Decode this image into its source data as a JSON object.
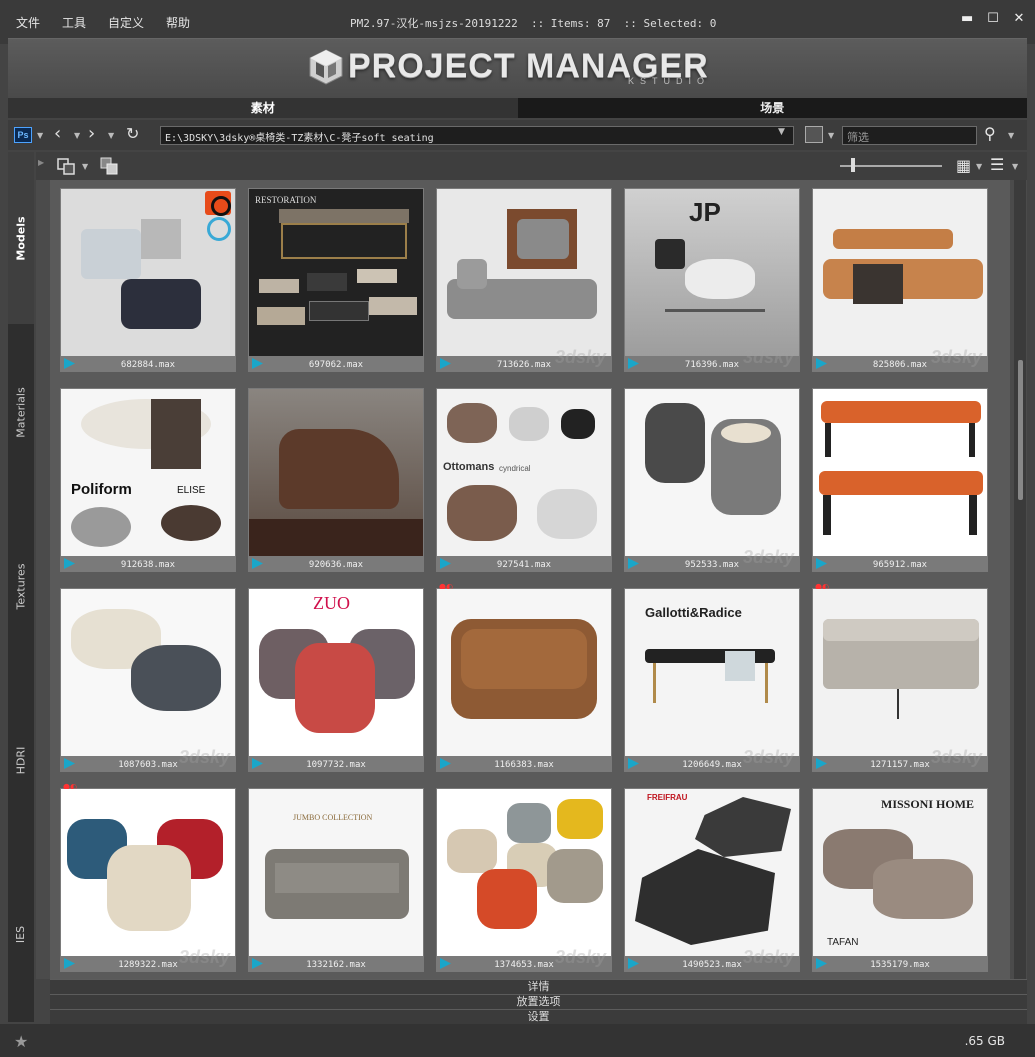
{
  "menu": [
    "文件",
    "工具",
    "自定义",
    "帮助"
  ],
  "window_title": "PM2.97-汉化-msjzs-20191222  :: Items: 87  :: Selected: 0",
  "logo": {
    "title": "PROJECT MANAGER",
    "subtitle": "KSTUDIO"
  },
  "tabs": {
    "assets": "素材",
    "scenes": "场景"
  },
  "toolbar": {
    "path": "E:\\3DSKY\\3dsky®桌椅类-TZ素材\\C-凳子soft seating",
    "filter_placeholder": "筛选"
  },
  "sidebar": [
    "Models",
    "Materials",
    "Textures",
    "HDRI",
    "IES"
  ],
  "items": [
    {
      "name": "682884.max",
      "color": "#dcdcdc"
    },
    {
      "name": "697062.max",
      "color": "#222222"
    },
    {
      "name": "713626.max",
      "color": "#e8e8e8"
    },
    {
      "name": "716396.max",
      "color": "#bdbdbd"
    },
    {
      "name": "825806.max",
      "color": "#f0f0f0"
    },
    {
      "name": "912638.max",
      "color": "#f6f6f6"
    },
    {
      "name": "920636.max",
      "color": "#7f776f"
    },
    {
      "name": "927541.max",
      "color": "#f2f2f2"
    },
    {
      "name": "952533.max",
      "color": "#f6f6f6"
    },
    {
      "name": "965912.max",
      "color": "#ffffff"
    },
    {
      "name": "1087603.max",
      "color": "#f8f8f8"
    },
    {
      "name": "1097732.max",
      "color": "#ffffff"
    },
    {
      "name": "1166383.max",
      "color": "#f6f6f6"
    },
    {
      "name": "1206649.max",
      "color": "#f4f4f4"
    },
    {
      "name": "1271157.max",
      "color": "#f2f2f2"
    },
    {
      "name": "1289322.max",
      "color": "#ffffff"
    },
    {
      "name": "1332162.max",
      "color": "#f6f6f6"
    },
    {
      "name": "1374653.max",
      "color": "#ffffff"
    },
    {
      "name": "1490523.max",
      "color": "#f4f4f4"
    },
    {
      "name": "1535179.max",
      "color": "#f2f2f2"
    }
  ],
  "thumb_text": {
    "restoration": "RESTORATION",
    "poliform": "Poliform",
    "elise": "ELISE",
    "ottomans": "Ottomans",
    "cyndrical": "cyndrical",
    "zuo": "ZUO",
    "gallotti": "Gallotti&Radice",
    "jumbo": "JUMBO COLLECTION",
    "freifrau": "FREIFRAU",
    "missoni": "MISSONI HOME",
    "tafan": "TAFAN",
    "watermark": "3dsky"
  },
  "panels": [
    "详情",
    "放置选项",
    "设置"
  ],
  "status": {
    "disk": ".65 GB"
  }
}
